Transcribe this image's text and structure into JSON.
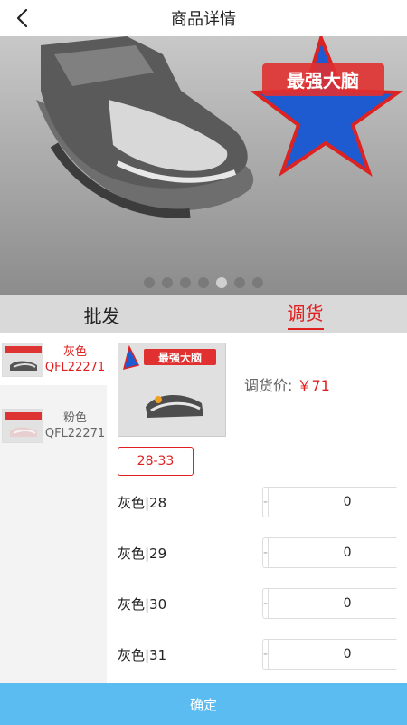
{
  "header": {
    "title": "商品详情"
  },
  "banner": {
    "slide_count": 7,
    "active_index": 4
  },
  "tabs": [
    {
      "label": "批发",
      "active": false
    },
    {
      "label": "调货",
      "active": true
    }
  ],
  "variants": [
    {
      "color": "灰色",
      "code": "QFL22271",
      "selected": true
    },
    {
      "color": "粉色",
      "code": "QFL22271",
      "selected": false
    }
  ],
  "product": {
    "price_label": "调货价: ",
    "price_value": "￥71",
    "size_chip": "28-33"
  },
  "qty_rows": [
    {
      "label": "灰色|28",
      "minus": "-",
      "value": "0",
      "plus": "+"
    },
    {
      "label": "灰色|29",
      "minus": "-",
      "value": "0",
      "plus": "+"
    },
    {
      "label": "灰色|30",
      "minus": "-",
      "value": "0",
      "plus": "+"
    },
    {
      "label": "灰色|31",
      "minus": "-",
      "value": "0",
      "plus": "+"
    }
  ],
  "footer": {
    "confirm_label": "确定"
  },
  "colors": {
    "accent": "#e02020",
    "confirm_bg": "#5bbcf2",
    "tab_bg": "#d9d9d9"
  },
  "icons": {
    "back": "chevron-left-icon"
  }
}
